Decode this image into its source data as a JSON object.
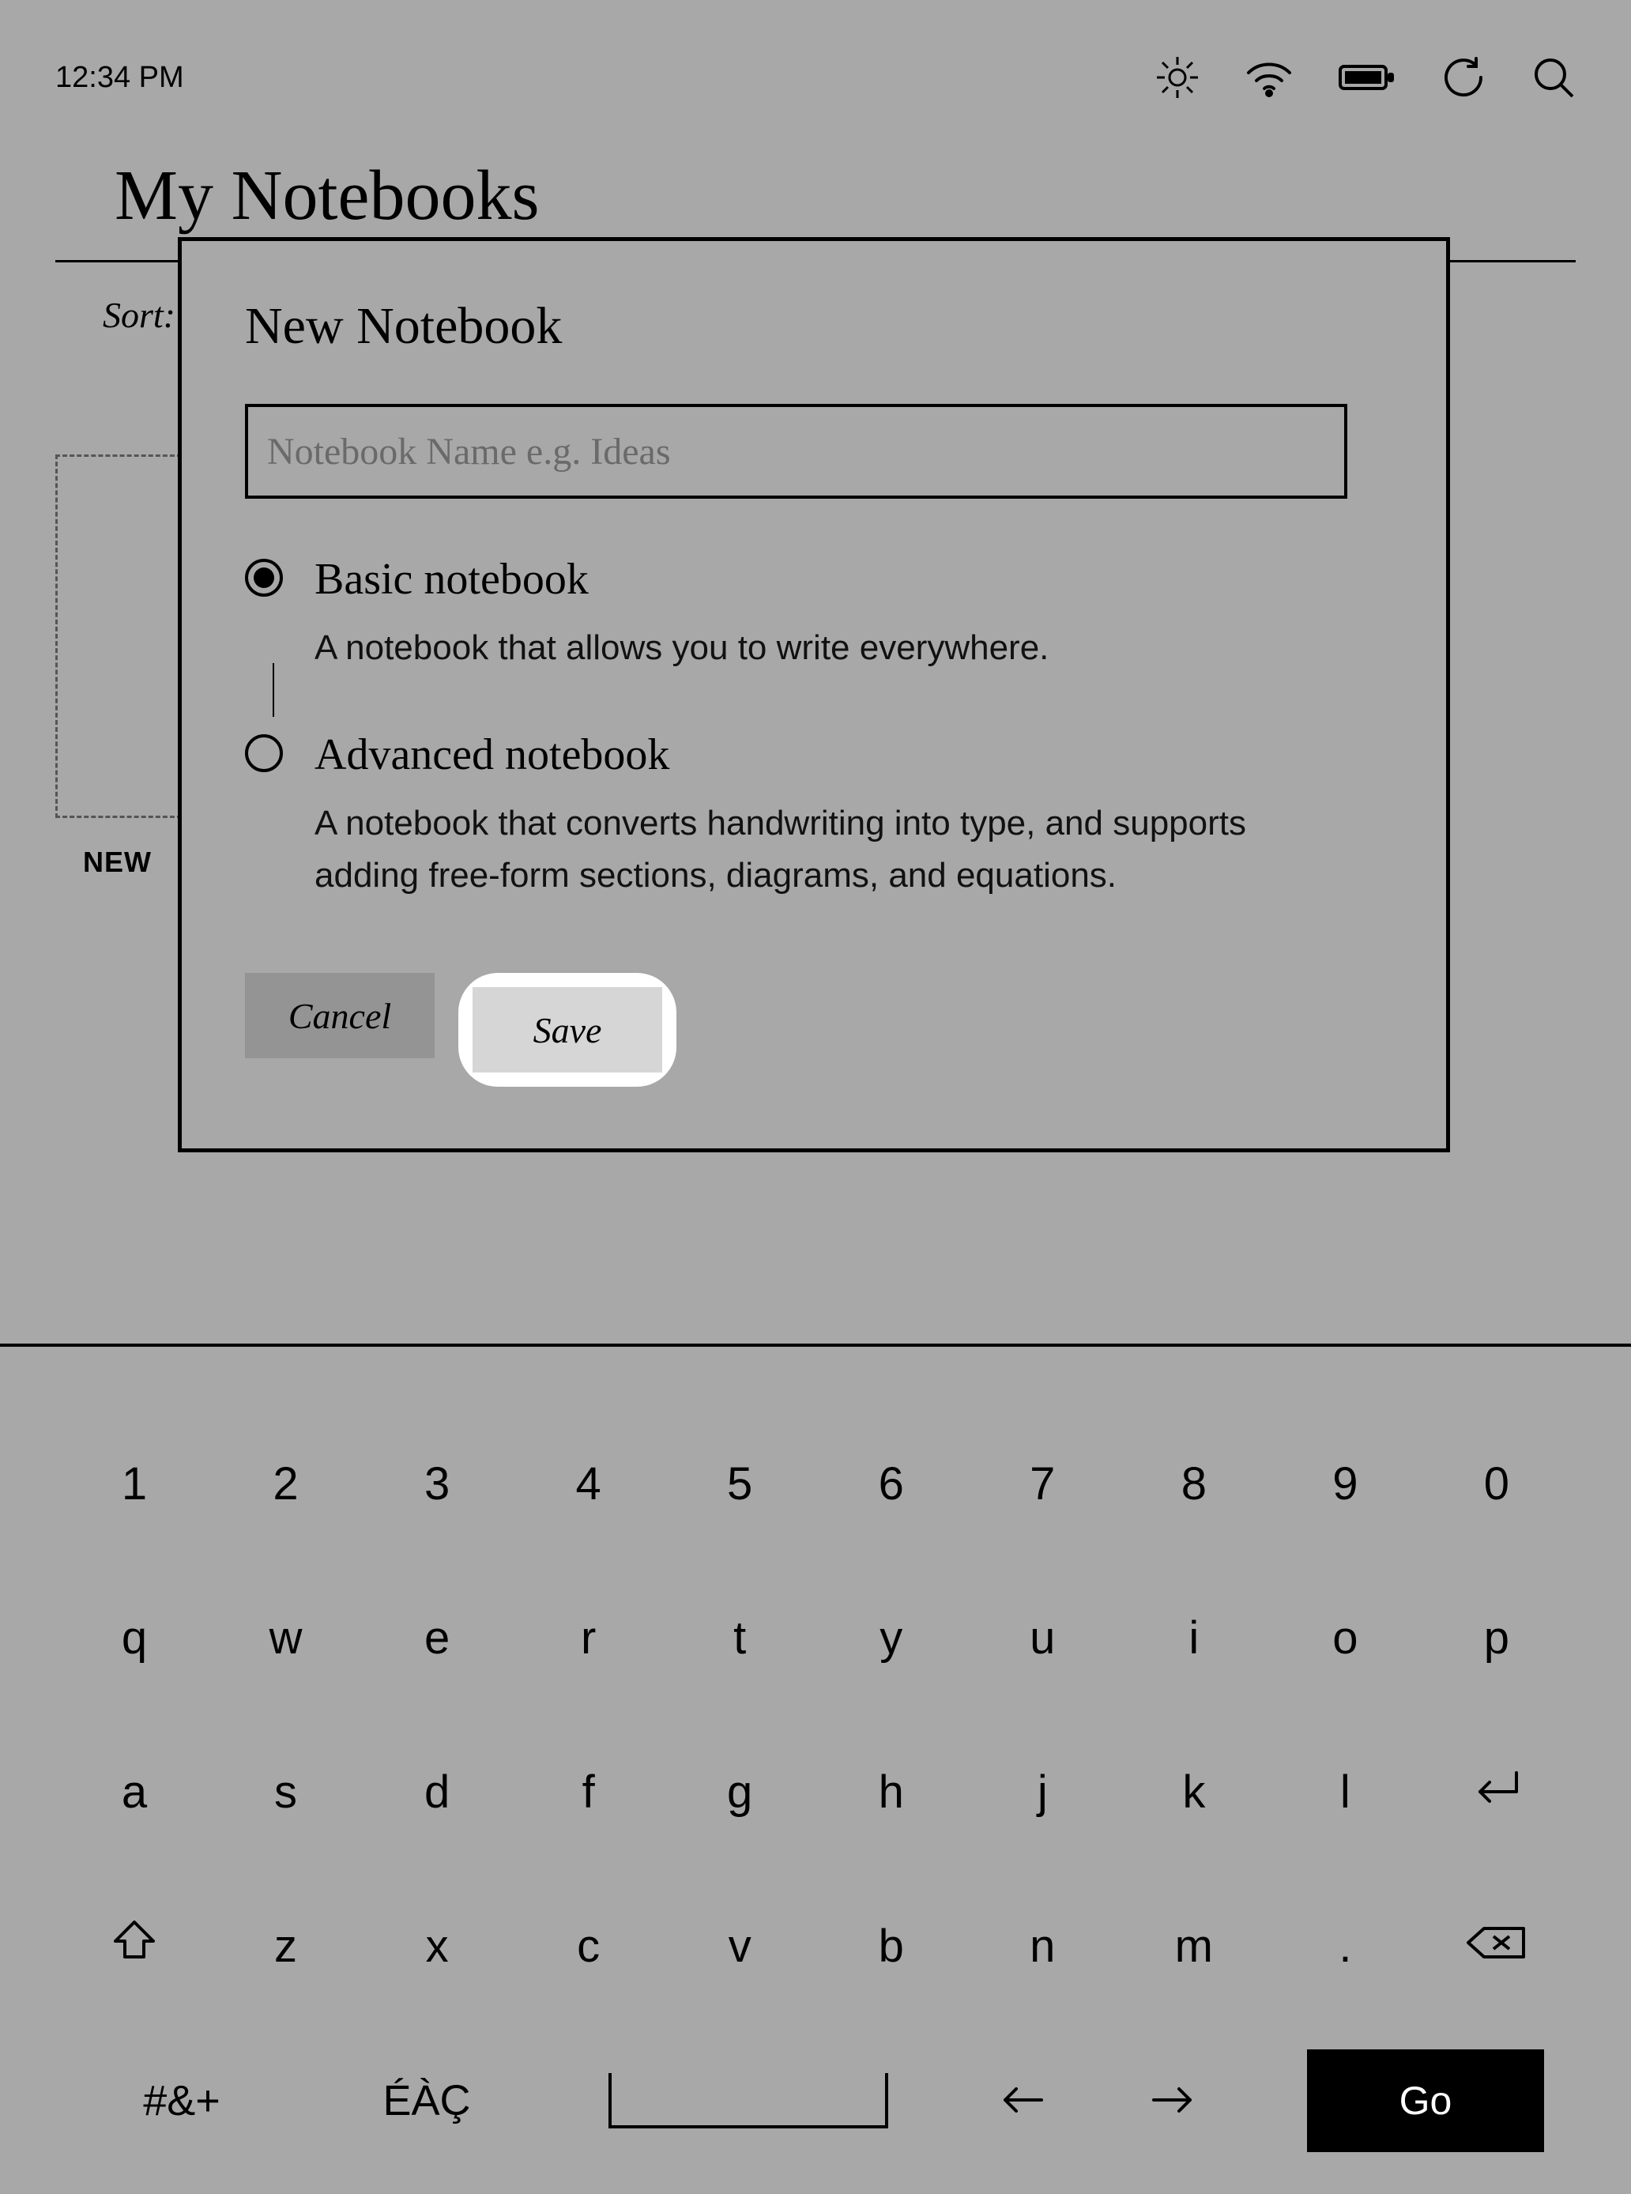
{
  "status": {
    "time": "12:34 PM"
  },
  "page": {
    "title": "My Notebooks",
    "sort_label": "Sort:",
    "new_tile": "NEW"
  },
  "dialog": {
    "title": "New Notebook",
    "name_placeholder": "Notebook Name e.g. Ideas",
    "name_value": "",
    "options": [
      {
        "title": "Basic notebook",
        "desc": "A notebook that allows you to write everywhere.",
        "selected": true
      },
      {
        "title": "Advanced notebook",
        "desc": "A notebook that converts handwriting into type, and supports adding free-form sections, diagrams, and equations.",
        "selected": false
      }
    ],
    "cancel": "Cancel",
    "save": "Save"
  },
  "keyboard": {
    "row1": [
      "1",
      "2",
      "3",
      "4",
      "5",
      "6",
      "7",
      "8",
      "9",
      "0"
    ],
    "row2": [
      "q",
      "w",
      "e",
      "r",
      "t",
      "y",
      "u",
      "i",
      "o",
      "p"
    ],
    "row3": [
      "a",
      "s",
      "d",
      "f",
      "g",
      "h",
      "j",
      "k",
      "l"
    ],
    "row4": [
      "z",
      "x",
      "c",
      "v",
      "b",
      "n",
      "m",
      "."
    ],
    "symbols": "#&+",
    "accents": "ÉÀÇ",
    "go": "Go"
  }
}
